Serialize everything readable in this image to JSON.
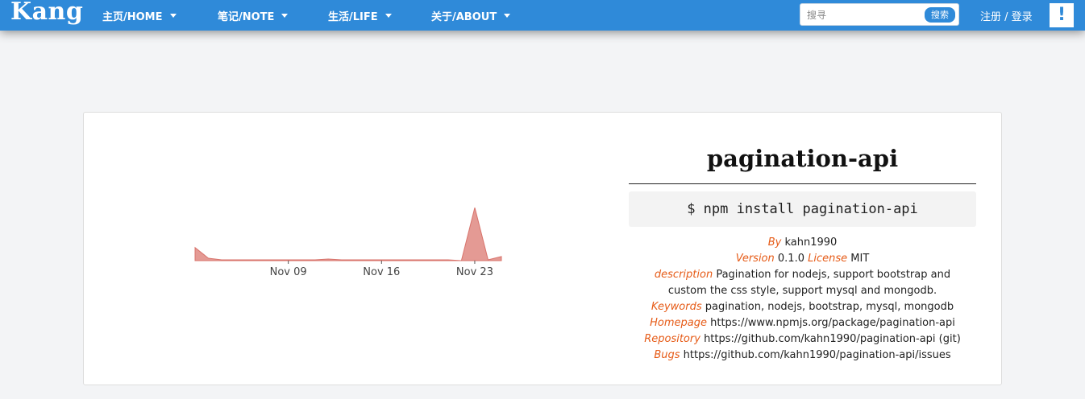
{
  "brand": "Kang",
  "nav": [
    {
      "label": "主页/HOME"
    },
    {
      "label": "笔记/NOTE"
    },
    {
      "label": "生活/LIFE"
    },
    {
      "label": "关于/ABOUT"
    }
  ],
  "search": {
    "placeholder": "搜寻",
    "button": "搜索"
  },
  "auth": {
    "label": "注册 / 登录"
  },
  "alert": {
    "icon": "exclamation-icon",
    "symbol": "!"
  },
  "colors": {
    "navbar": "#2f8ad9",
    "accent": "#e65b17",
    "chart_fill": "#e49a94",
    "chart_stroke": "#d8736b"
  },
  "package": {
    "name": "pagination-api",
    "install": "$ npm install pagination-api",
    "by_label": "By",
    "by": "kahn1990",
    "version_label": "Version",
    "version": "0.1.0",
    "license_label": "License",
    "license": "MIT",
    "description_label": "description",
    "description": "Pagination for nodejs, support bootstrap and custom the css style, support mysql and mongodb.",
    "keywords_label": "Keywords",
    "keywords": "pagination, nodejs, bootstrap, mysql, mongodb",
    "homepage_label": "Homepage",
    "homepage": "https://www.npmjs.org/package/pagination-api",
    "repository_label": "Repository",
    "repository": "https://github.com/kahn1990/pagination-api (git)",
    "bugs_label": "Bugs",
    "bugs": "https://github.com/kahn1990/pagination-api/issues"
  },
  "chart_data": {
    "type": "area",
    "x": [
      "Nov 02",
      "Nov 03",
      "Nov 04",
      "Nov 05",
      "Nov 06",
      "Nov 07",
      "Nov 08",
      "Nov 09",
      "Nov 10",
      "Nov 11",
      "Nov 12",
      "Nov 13",
      "Nov 14",
      "Nov 15",
      "Nov 16",
      "Nov 17",
      "Nov 18",
      "Nov 19",
      "Nov 20",
      "Nov 21",
      "Nov 22",
      "Nov 23",
      "Nov 24",
      "Nov 25"
    ],
    "values": [
      16,
      3,
      1,
      1,
      1,
      1,
      1,
      1,
      1,
      1,
      2,
      1,
      1,
      1,
      1,
      1,
      1,
      1,
      1,
      1,
      0,
      65,
      1,
      5
    ],
    "tick_labels": [
      "Nov 09",
      "Nov 16",
      "Nov 23"
    ],
    "ylim": [
      0,
      70
    ],
    "grid": false,
    "legend": "none"
  }
}
